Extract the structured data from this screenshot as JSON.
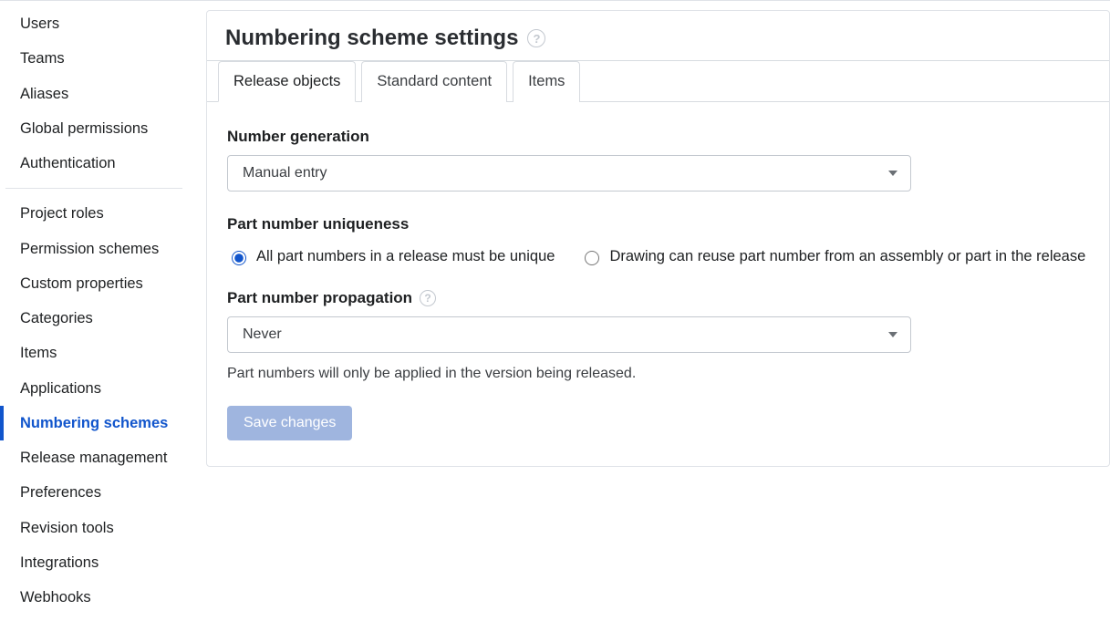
{
  "sidebar": {
    "group1": [
      {
        "label": "Users"
      },
      {
        "label": "Teams"
      },
      {
        "label": "Aliases"
      },
      {
        "label": "Global permissions"
      },
      {
        "label": "Authentication"
      }
    ],
    "group2": [
      {
        "label": "Project roles"
      },
      {
        "label": "Permission schemes"
      },
      {
        "label": "Custom properties"
      },
      {
        "label": "Categories"
      },
      {
        "label": "Items"
      },
      {
        "label": "Applications"
      },
      {
        "label": "Numbering schemes",
        "active": true
      },
      {
        "label": "Release management"
      },
      {
        "label": "Preferences"
      },
      {
        "label": "Revision tools"
      },
      {
        "label": "Integrations"
      },
      {
        "label": "Webhooks"
      }
    ]
  },
  "panel": {
    "title": "Numbering scheme settings",
    "help_glyph": "?"
  },
  "tabs": [
    {
      "label": "Release objects",
      "active": true
    },
    {
      "label": "Standard content"
    },
    {
      "label": "Items"
    }
  ],
  "form": {
    "number_generation": {
      "label": "Number generation",
      "value": "Manual entry"
    },
    "uniqueness": {
      "label": "Part number uniqueness",
      "option_all_unique": "All part numbers in a release must be unique",
      "option_drawing_reuse": "Drawing can reuse part number from an assembly or part in the release",
      "selected": "all_unique"
    },
    "propagation": {
      "label": "Part number propagation",
      "value": "Never",
      "note": "Part numbers will only be applied in the version being released."
    },
    "save_label": "Save changes"
  }
}
